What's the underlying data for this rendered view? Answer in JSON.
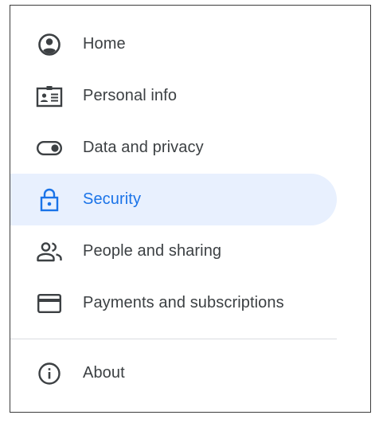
{
  "nav": {
    "items": [
      {
        "label": "Home",
        "icon": "account-circle-icon",
        "active": false
      },
      {
        "label": "Personal info",
        "icon": "id-card-icon",
        "active": false
      },
      {
        "label": "Data and privacy",
        "icon": "toggle-icon",
        "active": false
      },
      {
        "label": "Security",
        "icon": "lock-icon",
        "active": true
      },
      {
        "label": "People and sharing",
        "icon": "people-icon",
        "active": false
      },
      {
        "label": "Payments and subscriptions",
        "icon": "credit-card-icon",
        "active": false
      }
    ],
    "about": {
      "label": "About",
      "icon": "info-icon"
    }
  },
  "colors": {
    "accent": "#1a73e8",
    "active_bg": "#e8f0fe",
    "icon": "#3c4043",
    "text": "#3c4043",
    "divider": "#dadce0"
  }
}
